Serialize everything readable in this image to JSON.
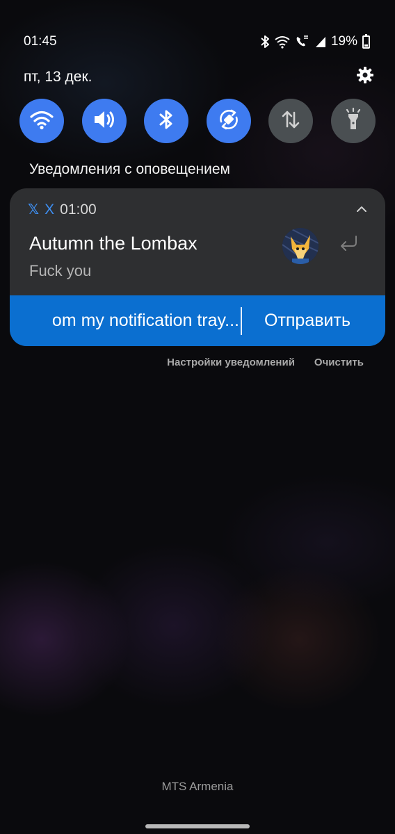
{
  "status_bar": {
    "time": "01:45",
    "battery": "19%",
    "battery_level": 0.19,
    "icons": [
      "bluetooth-icon",
      "wifi-icon",
      "volte-call-icon",
      "signal-icon",
      "battery-icon"
    ]
  },
  "header": {
    "date": "пт, 13 дек."
  },
  "quick_toggles": [
    {
      "name": "wifi",
      "state": "on"
    },
    {
      "name": "sound",
      "state": "on"
    },
    {
      "name": "bluetooth",
      "state": "on"
    },
    {
      "name": "auto-rotate",
      "state": "on"
    },
    {
      "name": "mobile-data",
      "state": "off"
    },
    {
      "name": "flashlight",
      "state": "off"
    }
  ],
  "section_title": "Уведомления с оповещением",
  "notification": {
    "app_name": "X",
    "time": "01:00",
    "title": "Autumn the Lombax",
    "body": "Fuck you",
    "reply_text": "om my notification tray...",
    "send_label": "Отправить"
  },
  "actions": {
    "settings": "Настройки уведомлений",
    "clear": "Очистить"
  },
  "carrier": "MTS Armenia",
  "colors": {
    "accent": "#3e7bf0",
    "reply_bar": "#0b6fd0",
    "card": "#2e2f31",
    "toggle_off": "#4a4f52"
  }
}
